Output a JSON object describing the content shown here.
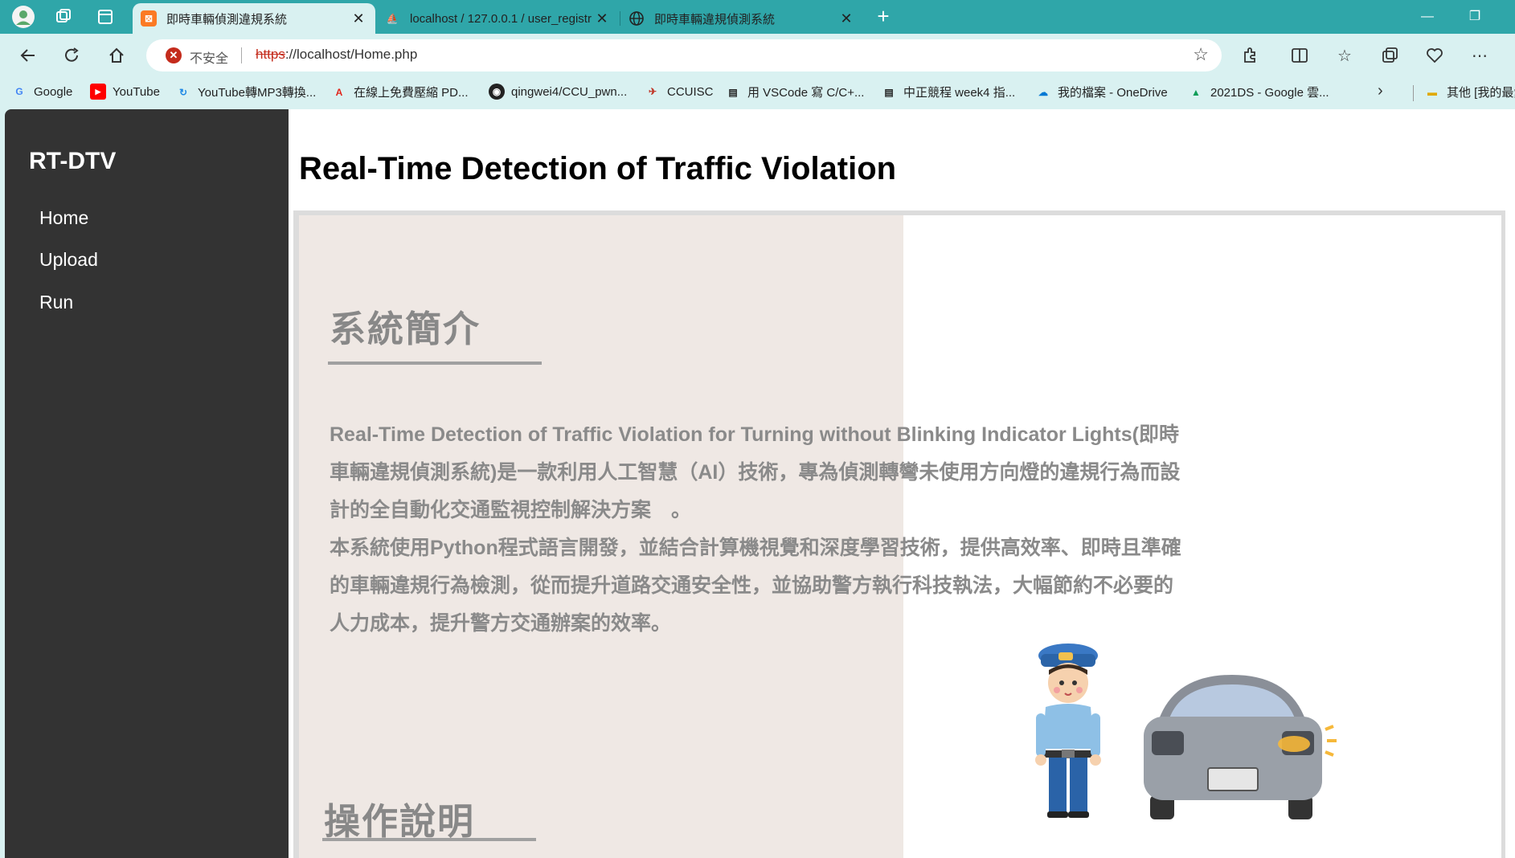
{
  "browser": {
    "tabs": [
      {
        "title": "即時車輛偵測違規系統",
        "active": true
      },
      {
        "title": "localhost / 127.0.0.1 / user_registr",
        "active": false
      },
      {
        "title": "即時車輛違規偵測系統",
        "active": false
      }
    ],
    "address": {
      "security_label": "不安全",
      "url_scheme": "https",
      "url_rest": "://localhost/Home.php"
    },
    "bookmarks": [
      {
        "label": "Google"
      },
      {
        "label": "YouTube"
      },
      {
        "label": "YouTube轉MP3轉換..."
      },
      {
        "label": "在線上免費壓縮 PD..."
      },
      {
        "label": "qingwei4/CCU_pwn..."
      },
      {
        "label": "CCUISC"
      },
      {
        "label": "用 VSCode 寫 C/C+..."
      },
      {
        "label": "中正競程 week4 指..."
      },
      {
        "label": "我的檔案 - OneDrive"
      },
      {
        "label": "2021DS - Google 雲..."
      },
      {
        "label": "其他 [我的最愛]"
      }
    ],
    "accent_color": "#2fa6a9"
  },
  "sidebar": {
    "brand": "RT-DTV",
    "links": [
      "Home",
      "Upload",
      "Run"
    ]
  },
  "main": {
    "title": "Real-Time Detection of Traffic Violation",
    "section1_heading": "系統簡介",
    "intro_lines": [
      "Real-Time Detection of Traffic Violation for Turning without Blinking Indicator Lights(即時車輛違規偵測系統)是一款利用人工智慧（AI）技術，專為偵測轉彎未使用方向燈的違規行為而設計的全自動化交通監視控制解決方案　。",
      "本系統使用Python程式語言開發，並結合計算機視覺和深度學習技術，提供高效率、即時且準確的車輛違規行為檢測，從而提升道路交通安全性，並協助警方執行科技執法，大幅節約不必要的人力成本，提升警方交通辦案的效率。"
    ],
    "section2_heading": "操作說明"
  }
}
